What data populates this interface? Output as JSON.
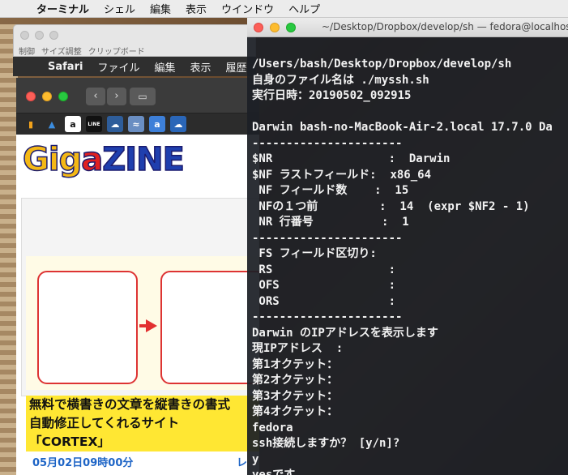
{
  "menubar": {
    "apple_icon": "apple-icon",
    "app_name": "ターミナル",
    "items": [
      "シェル",
      "編集",
      "表示",
      "ウインドウ",
      "ヘルプ"
    ]
  },
  "back_window": {
    "tools": [
      "制御",
      "サイズ調整",
      "クリップボード"
    ]
  },
  "safari_menubar": {
    "app_name": "Safari",
    "items": [
      "ファイル",
      "編集",
      "表示",
      "履歴"
    ]
  },
  "safari": {
    "logo": {
      "g": "G",
      "i": "i",
      "g2": "g",
      "a": "a",
      "z": "Z",
      "ine": "INE"
    },
    "favorites": [
      "chart-icon",
      "drive-icon",
      "amazon-icon",
      "line-icon",
      "cloud-icon",
      "wifi-icon",
      "amazon-icon",
      "cloud-icon"
    ],
    "headline_lines": [
      "無料で横書きの文章を縦書きの書式",
      "自動修正してくれるサイト",
      "「CORTEX」"
    ],
    "date": "05月02日09時00分",
    "date_right": "レ"
  },
  "terminal": {
    "title": "~/Desktop/Dropbox/develop/sh — fedora@localhost.localdomain",
    "lines": [
      "/Users/bash/Desktop/Dropbox/develop/sh",
      "自身のファイル名は ./myssh.sh",
      "実行日時：20190502_092915",
      "",
      "Darwin bash-no-MacBook-Air-2.local 17.7.0 Da",
      "----------------------",
      "$NR                 :  Darwin",
      "$NF ラストフィールド:  x86_64",
      " NF フィールド数    :  15",
      " NFの１つ前         :  14  (expr $NF2 - 1)",
      " NR 行番号          :  1",
      "----------------------",
      " FS フィールド区切り:",
      " RS                 :",
      " OFS                :",
      " ORS                :",
      "----------------------",
      "Darwin のIPアドレスを表示します",
      "現IPアドレス  :",
      "第1オクテット：",
      "第2オクテット：",
      "第3オクテット：",
      "第4オクテット：",
      "fedora",
      "ssh接続しますか？ [y/n]?",
      "y",
      "yesです"
    ]
  }
}
